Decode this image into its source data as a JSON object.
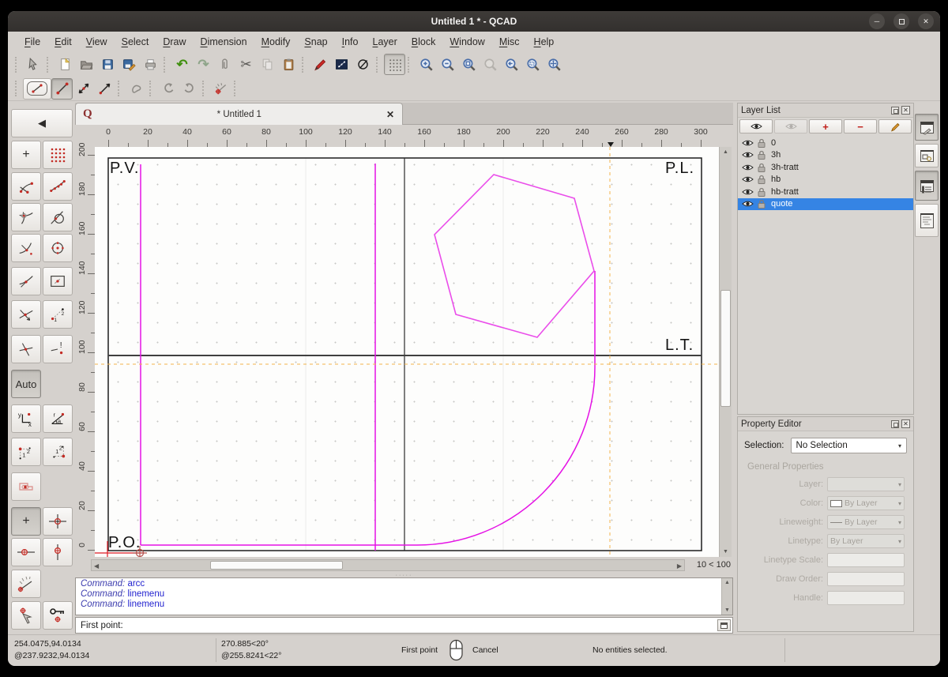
{
  "window": {
    "title": "Untitled 1 * - QCAD"
  },
  "icons": {
    "minimize": "─",
    "close": "✕",
    "back": "◀",
    "scroll_up": "▲",
    "scroll_down": "▼",
    "scroll_left": "◀",
    "scroll_right": "▶",
    "plus": "+",
    "minus": "−",
    "undo": "↶",
    "redo": "↷",
    "cut": "✂",
    "combo_arrow": "▾",
    "splitter_dots": "·····"
  },
  "menu": {
    "items": [
      "File",
      "Edit",
      "View",
      "Select",
      "Draw",
      "Dimension",
      "Modify",
      "Snap",
      "Info",
      "Layer",
      "Block",
      "Window",
      "Misc",
      "Help"
    ]
  },
  "tab": {
    "title": "* Untitled 1"
  },
  "rulers": {
    "horizontal": [
      "0",
      "20",
      "40",
      "60",
      "80",
      "100",
      "120",
      "140",
      "160",
      "180",
      "200",
      "220",
      "240",
      "260",
      "280",
      "300"
    ],
    "vertical": [
      "200",
      "180",
      "160",
      "140",
      "120",
      "100",
      "80",
      "60",
      "40",
      "20",
      "0"
    ]
  },
  "drawing": {
    "labels": {
      "pv": "P.V.",
      "pl": "P.L.",
      "lt": "L.T.",
      "po": "P.O."
    },
    "grid_indicator": "10 < 100",
    "colors": {
      "magenta": "#e512e5",
      "magenta_light": "#ea4dea",
      "crosshair": "#f2b34c",
      "origin_red": "#e01b24",
      "selection_blue": "#3584e4"
    }
  },
  "sidebar": {
    "auto_label": "Auto"
  },
  "layer_list": {
    "title": "Layer List",
    "layers": [
      {
        "name": "0"
      },
      {
        "name": "3h"
      },
      {
        "name": "3h-tratt"
      },
      {
        "name": "hb"
      },
      {
        "name": "hb-tratt"
      },
      {
        "name": "quote",
        "selected": true
      }
    ]
  },
  "property_editor": {
    "title": "Property Editor",
    "selection_label": "Selection:",
    "selection_value": "No Selection",
    "section": "General Properties",
    "fields": [
      {
        "label": "Layer:",
        "value": ""
      },
      {
        "label": "Color:",
        "value": "By Layer"
      },
      {
        "label": "Lineweight:",
        "value": "By Layer"
      },
      {
        "label": "Linetype:",
        "value": "By Layer"
      },
      {
        "label": "Linetype Scale:",
        "value": ""
      },
      {
        "label": "Draw Order:",
        "value": ""
      },
      {
        "label": "Handle:",
        "value": ""
      }
    ]
  },
  "command_line": {
    "history": [
      {
        "prefix": "Command:",
        "text": "arcc"
      },
      {
        "prefix": "Command:",
        "text": "linemenu"
      },
      {
        "prefix": "Command:",
        "text": "linemenu"
      }
    ],
    "prompt": "First point:"
  },
  "status_bar": {
    "abs_coord": "254.0475,94.0134",
    "rel_coord": "@237.9232,94.0134",
    "abs_polar": "270.885<20°",
    "rel_polar": "@255.8241<22°",
    "left_click_action": "First point",
    "right_click_action": "Cancel",
    "selection_status": "No entities selected."
  }
}
